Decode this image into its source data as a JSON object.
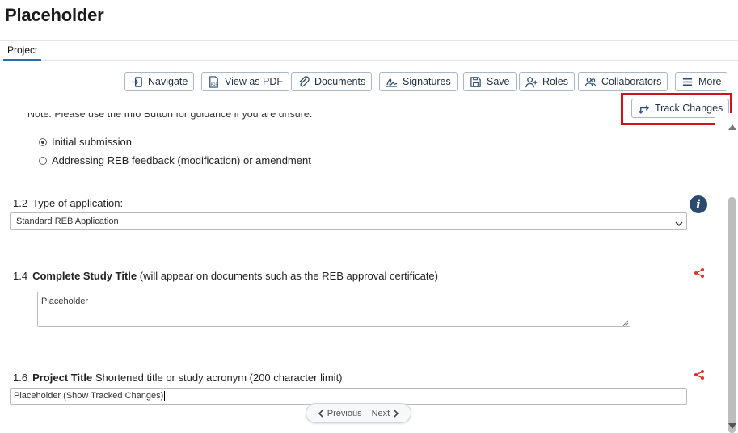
{
  "page": {
    "title": "Placeholder"
  },
  "tabs": [
    {
      "label": "Project"
    }
  ],
  "toolbar": {
    "navigate": "Navigate",
    "view_pdf": "View as PDF",
    "documents": "Documents",
    "signatures": "Signatures",
    "save": "Save",
    "roles": "Roles",
    "collaborators": "Collaborators",
    "more": "More",
    "track_changes": "Track Changes"
  },
  "form": {
    "note_line": "Note: Please use the Info Button for guidance if you are unsure.",
    "radio_options": [
      {
        "label": "Initial submission",
        "checked": true
      },
      {
        "label": "Addressing REB feedback (modification) or amendment",
        "checked": false
      }
    ],
    "q1_2": {
      "num": "1.2",
      "label": "Type of application:",
      "value": "Standard REB Application"
    },
    "q1_4": {
      "num": "1.4",
      "bold": "Complete Study Title",
      "rest": " (will appear on documents such as the REB approval certificate)",
      "value": "Placeholder"
    },
    "q1_6": {
      "num": "1.6",
      "bold": "Project Title",
      "rest": " Shortened title or study acronym (200 character limit)",
      "value": "Placeholder (Show Tracked Changes)"
    }
  },
  "pager": {
    "previous": "Previous",
    "next": "Next"
  },
  "colors": {
    "accent": "#2b6cb0",
    "highlight": "#d0111d",
    "share": "#e0302a",
    "info": "#2c4a6e"
  }
}
